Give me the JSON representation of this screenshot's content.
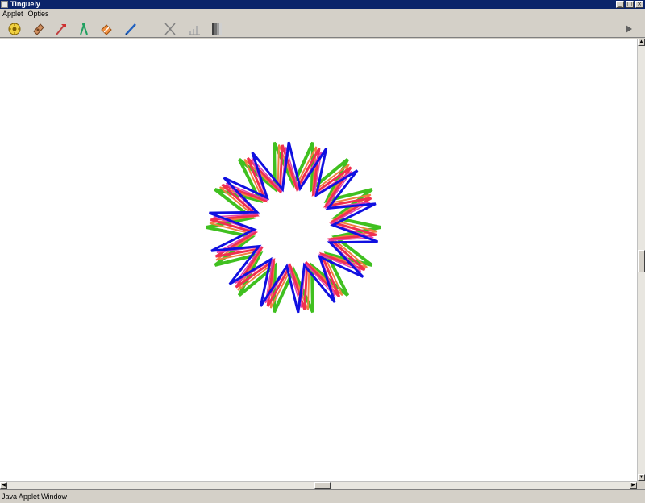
{
  "window": {
    "title": "Tinguely",
    "buttons": {
      "minimize": "_",
      "maximize": "□",
      "close": "×"
    }
  },
  "menubar": {
    "items": [
      {
        "label": "Applet"
      },
      {
        "label": "Opties"
      }
    ]
  },
  "toolbar": {
    "tools": [
      {
        "icon": "gear-wheel-icon",
        "color": "#c8a000"
      },
      {
        "icon": "eraser-pad-icon",
        "color": "#c08050"
      },
      {
        "icon": "hammer-icon",
        "color": "#d03030"
      },
      {
        "icon": "compass-icon",
        "color": "#20a060"
      },
      {
        "icon": "eraser-icon",
        "color": "#e08030"
      },
      {
        "icon": "pen-icon",
        "color": "#2060c0"
      },
      {
        "icon": "cross-icon",
        "color": "#808080"
      },
      {
        "icon": "bar-chart-icon",
        "color": "#a0a0a0"
      },
      {
        "icon": "gradient-icon",
        "color": "#606060"
      },
      {
        "icon": "play-icon",
        "color": "#606060"
      }
    ]
  },
  "drawing": {
    "pattern": "spirograph-star",
    "colors": {
      "blue": "#1010e0",
      "red": "#f03050",
      "green": "#40c020",
      "orange": "#f08040",
      "magenta": "#e040b0"
    }
  },
  "statusbar": {
    "text": "Java Applet Window"
  }
}
